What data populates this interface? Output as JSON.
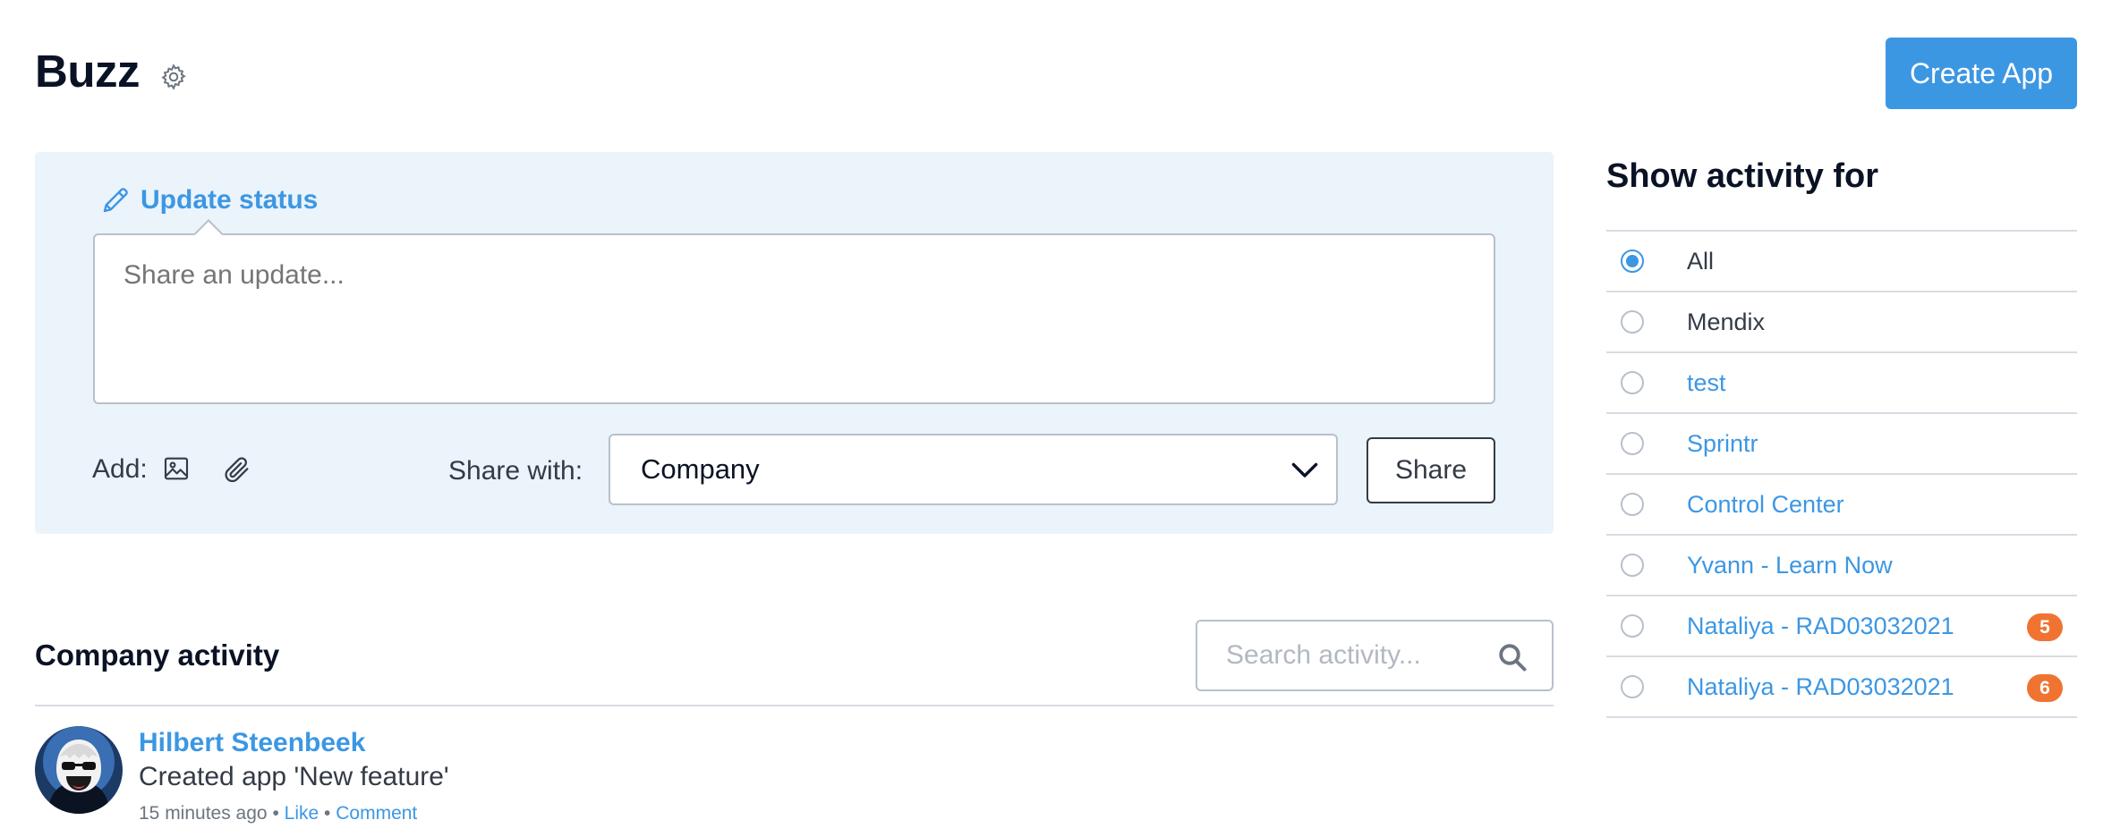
{
  "header": {
    "title": "Buzz",
    "create_app_label": "Create App"
  },
  "status": {
    "tab_label": "Update status",
    "placeholder": "Share an update...",
    "add_label": "Add:",
    "share_with_label": "Share with:",
    "share_with_value": "Company",
    "share_button_label": "Share"
  },
  "activity": {
    "title": "Company activity",
    "search_placeholder": "Search activity...",
    "feed": [
      {
        "author": "Hilbert Steenbeek",
        "text": "Created app 'New feature'",
        "time": "15 minutes ago",
        "separator": "•",
        "like_label": "Like",
        "comment_label": "Comment"
      }
    ]
  },
  "sidebar": {
    "title": "Show activity for",
    "items": [
      {
        "label": "All",
        "checked": true,
        "badge": ""
      },
      {
        "label": "Mendix",
        "checked": false,
        "badge": ""
      },
      {
        "label": "test",
        "checked": false,
        "badge": ""
      },
      {
        "label": "Sprintr",
        "checked": false,
        "badge": ""
      },
      {
        "label": "Control Center",
        "checked": false,
        "badge": ""
      },
      {
        "label": "Yvann - Learn Now",
        "checked": false,
        "badge": ""
      },
      {
        "label": "Nataliya - RAD03032021",
        "checked": false,
        "badge": "5"
      },
      {
        "label": "Nataliya - RAD03032021",
        "checked": false,
        "badge": "6"
      }
    ]
  },
  "colors": {
    "accent": "#3c97e3",
    "badge": "#f07332",
    "panel_bg": "#ebf3fb"
  },
  "icons": [
    "gear-icon",
    "pencil-icon",
    "image-icon",
    "paperclip-icon",
    "chevron-down-icon",
    "search-icon"
  ]
}
